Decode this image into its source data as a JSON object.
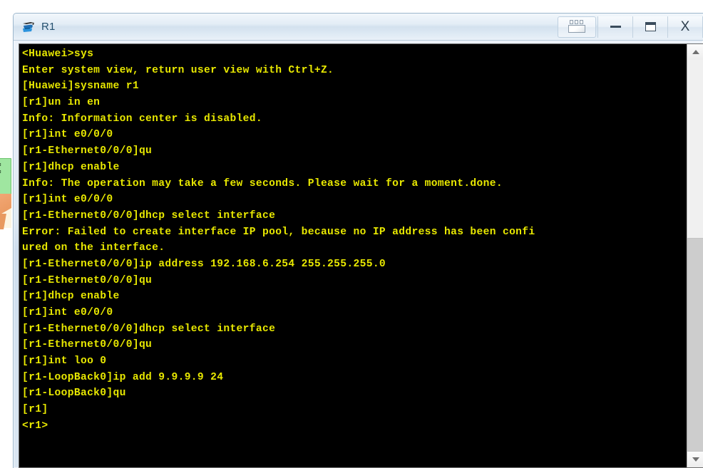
{
  "background": {
    "green_note_text": "⊃⊐\n⊃⊐\n-◢",
    "description": "partially occluded application behind the terminal window"
  },
  "window": {
    "title": "R1",
    "icon": "router-icon",
    "buttons": [
      {
        "name": "cascade-windows-button",
        "label": "",
        "icon": "cascade-windows-icon"
      },
      {
        "name": "minimize-button",
        "label": "—",
        "icon": "minimize-icon"
      },
      {
        "name": "maximize-button",
        "label": "",
        "icon": "maximize-icon"
      },
      {
        "name": "close-button",
        "label": "X",
        "icon": "close-icon"
      }
    ]
  },
  "terminal": {
    "foreground_color": "#e8e800",
    "background_color": "#000000",
    "lines": [
      "<Huawei>sys",
      "Enter system view, return user view with Ctrl+Z.",
      "[Huawei]sysname r1",
      "[r1]un in en",
      "Info: Information center is disabled.",
      "[r1]int e0/0/0",
      "[r1-Ethernet0/0/0]qu",
      "[r1]dhcp enable",
      "Info: The operation may take a few seconds. Please wait for a moment.done.",
      "[r1]int e0/0/0",
      "[r1-Ethernet0/0/0]dhcp select interface",
      "Error: Failed to create interface IP pool, because no IP address has been confi",
      "ured on the interface.",
      "[r1-Ethernet0/0/0]ip address 192.168.6.254 255.255.255.0",
      "[r1-Ethernet0/0/0]qu",
      "[r1]dhcp enable",
      "[r1]int e0/0/0",
      "[r1-Ethernet0/0/0]dhcp select interface",
      "[r1-Ethernet0/0/0]qu",
      "[r1]int loo 0",
      "[r1-LoopBack0]ip add 9.9.9.9 24",
      "[r1-LoopBack0]qu",
      "[r1]",
      "<r1>"
    ]
  },
  "scrollbar": {
    "up_arrow": "scroll-up-icon",
    "down_arrow": "scroll-down-icon",
    "thumb": "scrollbar-thumb"
  }
}
